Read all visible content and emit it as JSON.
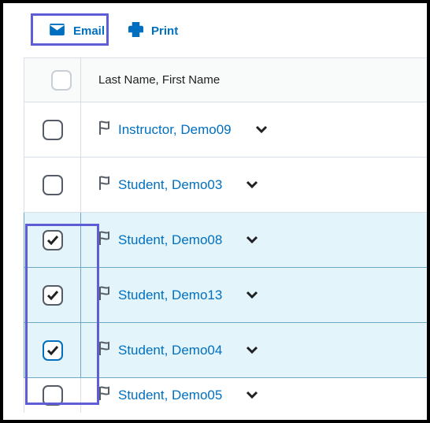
{
  "toolbar": {
    "email_label": "Email",
    "print_label": "Print"
  },
  "table": {
    "header": "Last Name, First Name"
  },
  "rows": [
    {
      "name": "Instructor, Demo09",
      "checked": false,
      "selected": false,
      "blue_checkbox": false,
      "partial": false
    },
    {
      "name": "Student, Demo03",
      "checked": false,
      "selected": false,
      "blue_checkbox": false,
      "partial": false
    },
    {
      "name": "Student, Demo08",
      "checked": true,
      "selected": true,
      "blue_checkbox": false,
      "partial": false
    },
    {
      "name": "Student, Demo13",
      "checked": true,
      "selected": true,
      "blue_checkbox": false,
      "partial": false
    },
    {
      "name": "Student, Demo04",
      "checked": true,
      "selected": true,
      "blue_checkbox": true,
      "partial": false
    },
    {
      "name": "Student, Demo05",
      "checked": false,
      "selected": false,
      "blue_checkbox": false,
      "partial": true
    }
  ]
}
